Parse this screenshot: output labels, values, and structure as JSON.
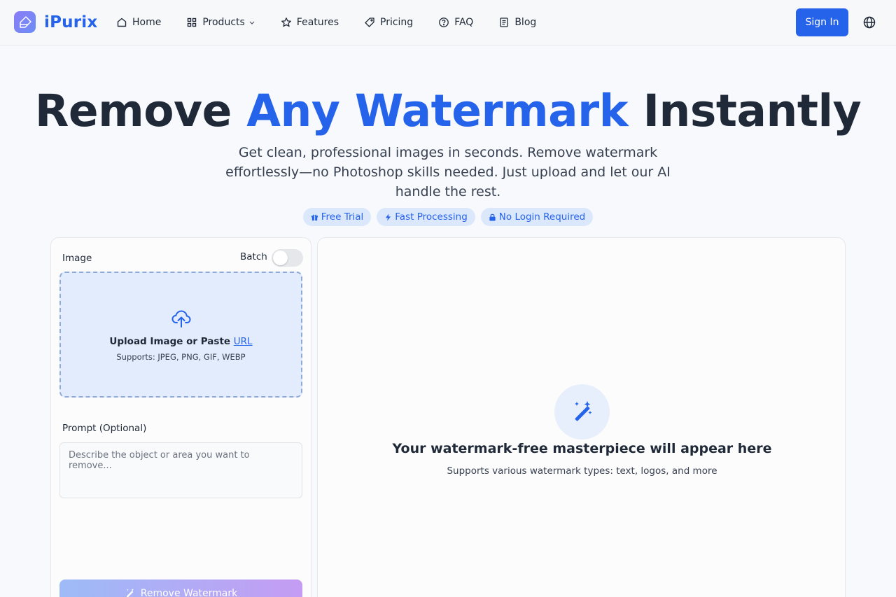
{
  "brand": {
    "name": "iPurix"
  },
  "nav": {
    "items": [
      {
        "label": "Home",
        "icon": "home-icon"
      },
      {
        "label": "Products",
        "icon": "grid-icon",
        "has_dropdown": true
      },
      {
        "label": "Features",
        "icon": "star-icon"
      },
      {
        "label": "Pricing",
        "icon": "tag-icon"
      },
      {
        "label": "FAQ",
        "icon": "help-circle-icon"
      },
      {
        "label": "Blog",
        "icon": "document-icon"
      }
    ],
    "sign_in": "Sign In",
    "language_icon": "globe-icon"
  },
  "hero": {
    "title_part1": "Remove",
    "title_accent": "Any Watermark",
    "title_part2": "Instantly",
    "subtitle": "Get clean, professional images in seconds. Remove watermark effortlessly—no Photoshop skills needed. Just upload and let our AI handle the rest.",
    "badges": [
      {
        "label": "Free Trial",
        "icon": "gift-icon"
      },
      {
        "label": "Fast Processing",
        "icon": "bolt-icon"
      },
      {
        "label": "No Login Required",
        "icon": "lock-icon"
      }
    ]
  },
  "form": {
    "image_label": "Image",
    "batch_label": "Batch",
    "batch_enabled": false,
    "upload_text": "Upload Image or Paste",
    "upload_url": "URL",
    "formats": "Supports: JPEG, PNG, GIF, WEBP",
    "prompt_label": "Prompt (Optional)",
    "prompt_placeholder": "Describe the object or area you want to remove...",
    "prompt_value": "",
    "submit_label": "Remove Watermark"
  },
  "result": {
    "title": "Your watermark-free masterpiece will appear here",
    "subtitle": "Supports various watermark types: text, logos, and more"
  },
  "colors": {
    "accent": "#2563eb",
    "badge_bg": "#dbe7fb",
    "dropzone_bg": "#e3ecfd",
    "button_gradient_start": "#9dbbf7",
    "button_gradient_end": "#c49cf3"
  }
}
